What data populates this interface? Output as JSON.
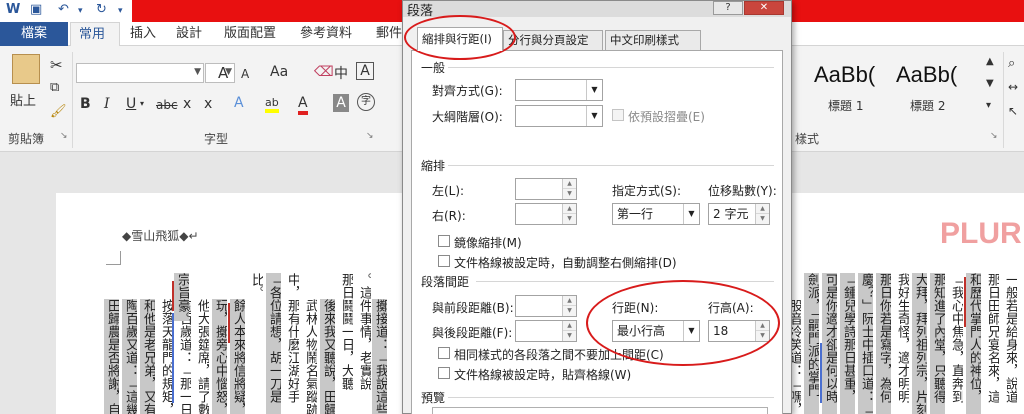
{
  "quick_access": {
    "word_icon": "word-logo-icon",
    "save_icon": "save-icon",
    "undo_icon": "undo-icon",
    "redo_icon": "redo-icon"
  },
  "ribbon_tabs": [
    "檔案",
    "常用",
    "插入",
    "設計",
    "版面配置",
    "參考資料",
    "郵件"
  ],
  "ribbon": {
    "clipboard": {
      "paste_label": "貼上",
      "group_label": "剪貼簿"
    },
    "font": {
      "group_label": "字型",
      "grow": "A",
      "shrink": "A",
      "case": "Aa",
      "phonetic": "中",
      "border_char": "A",
      "bold": "B",
      "italic": "I",
      "underline": "U",
      "strike": "abc",
      "sub": "x",
      "sup": "x",
      "text_effect": "A",
      "highlight": "ab",
      "font_color": "A",
      "shade_char": "A",
      "enclose": "字"
    },
    "styles": {
      "group_label": "樣式",
      "samples": [
        {
          "sample": "AaBb(",
          "name": "標題 1"
        },
        {
          "sample": "AaBb(",
          "name": "標題 2"
        }
      ]
    }
  },
  "document": {
    "author_line": "◆雪山飛狐◆↵",
    "watermark": "PLUR",
    "columns": [
      "。這件事情，老實說",
      "那日鬪鬪一日，大聽",
      "後來我又聽說，田歸",
      "武林人物鬧名氣蹤跡",
      "中，那有什麼江湖好手",
      "「各位請想，胡一刀是",
      "比。",
      "餘人本來將信將疑，聽",
      "玩，擲旁心中惱怒，卻",
      "他大張筵席，請了數百",
      "陶百歲道：「那一日天",
      "按落天龍門的規矩，又",
      "和他是老兄弟，又有同",
      "陶百歲又道：「這幾年",
      "田歸農是否將謝，自己",
      "擲接道：「我說這些話",
      "宗旨豪。"
    ],
    "right_columns": [
      "一般若是給身來，說道",
      "那日田師兄宴名來，這",
      "和歷代掌門人的神位，",
      "「我心中焦急，直奔到",
      "那知進了內堂，只聽得",
      "大拜，拜列祖列宗，片刻",
      "我好生奇怪，適才明明",
      "那日你若是寫字，為何",
      "慶？」阮士中插口道：「",
      "「鍾兒學詩那日甚重，",
      "可是你適才卻是何以時",
      "劍派，「嗣門派的掌門",
      "股音冷笑道：「嘿，我"
    ]
  },
  "dialog": {
    "title": "段落",
    "help": "?",
    "close": "✕",
    "tabs": [
      "縮排與行距(I)",
      "分行與分頁設定(P)",
      "中文印刷樣式(H)"
    ],
    "general": {
      "section": "一般",
      "alignment_label": "對齊方式(G):",
      "alignment_value": "",
      "outline_label": "大綱階層(O):",
      "outline_value": "",
      "collapse_label": "依預設摺疊(E)"
    },
    "indent": {
      "section": "縮排",
      "left_label": "左(L):",
      "left_value": "",
      "right_label": "右(R):",
      "right_value": "",
      "special_label": "指定方式(S):",
      "special_value": "第一行",
      "by_label": "位移點數(Y):",
      "by_value": "2 字元",
      "mirror_label": "鏡像縮排(M)",
      "auto_adjust_label": "文件格線被設定時，自動調整右側縮排(D)"
    },
    "spacing": {
      "section": "段落間距",
      "before_label": "與前段距離(B):",
      "before_value": "",
      "after_label": "與後段距離(F):",
      "after_value": "",
      "line_spacing_label": "行距(N):",
      "line_spacing_value": "最小行高",
      "at_label": "行高(A):",
      "at_value": "18",
      "no_space_same_style_label": "相同樣式的各段落之間不要加上間距(C)",
      "snap_grid_label": "文件格線被設定時，貼齊格線(W)"
    },
    "preview": {
      "section": "預覽"
    }
  }
}
